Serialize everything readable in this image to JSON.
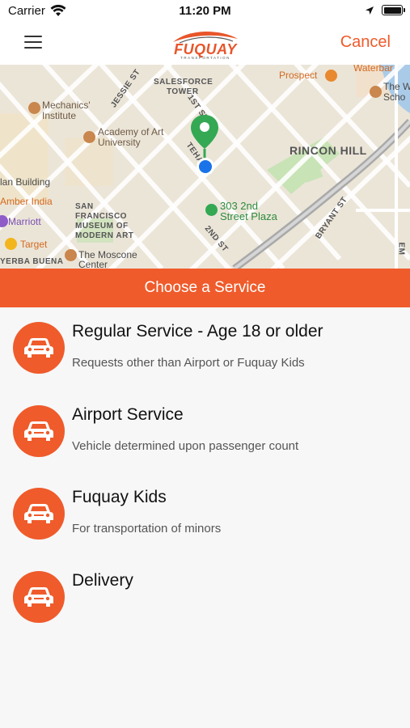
{
  "status_bar": {
    "carrier": "Carrier",
    "time": "11:20 PM"
  },
  "nav": {
    "logo_text": "FUQUAY",
    "logo_tagline": "TRANSPORTATION",
    "cancel_label": "Cancel"
  },
  "map": {
    "labels": {
      "waterbar": "Waterbar",
      "prospect": "Prospect",
      "the_w": "The W",
      "scho": "Scho",
      "salesforce": "SALESFORCE",
      "tower": "TOWER",
      "jessie": "JESSIE ST",
      "mechanics": "Mechanics'",
      "institute": "Institute",
      "first_st": "1ST ST",
      "academy_1": "Academy of Art",
      "academy_2": "University",
      "rincon": "RINCON HILL",
      "teha": "TEHA",
      "lan_building": "lan Building",
      "amber_india": "Amber India",
      "san": "SAN",
      "francisco": "FRANCISCO",
      "museum_of": "MUSEUM OF",
      "modern_art": "MODERN ART",
      "plaza_1": "303 2nd",
      "plaza_2": "Street Plaza",
      "bryant": "BRYANT ST",
      "marriott": "Marriott",
      "target": "Target",
      "second_st": "2ND ST",
      "yerba": "YERBA BUENA",
      "moscone_1": "The Moscone",
      "moscone_2": "Center",
      "em": "EM"
    }
  },
  "banner": {
    "title": "Choose a Service"
  },
  "services": [
    {
      "title": "Regular Service - Age 18 or older",
      "description": "Requests other than Airport or Fuquay Kids",
      "icon": "car-icon"
    },
    {
      "title": "Airport Service",
      "description": "Vehicle determined upon passenger count",
      "icon": "car-icon"
    },
    {
      "title": "Fuquay Kids",
      "description": "For transportation of minors",
      "icon": "car-icon"
    },
    {
      "title": "Delivery",
      "description": "",
      "icon": "car-icon"
    }
  ],
  "colors": {
    "accent": "#ef5b2b",
    "map_bg": "#ece6d9",
    "pin_green": "#34a853",
    "location_blue": "#1a73e8"
  }
}
